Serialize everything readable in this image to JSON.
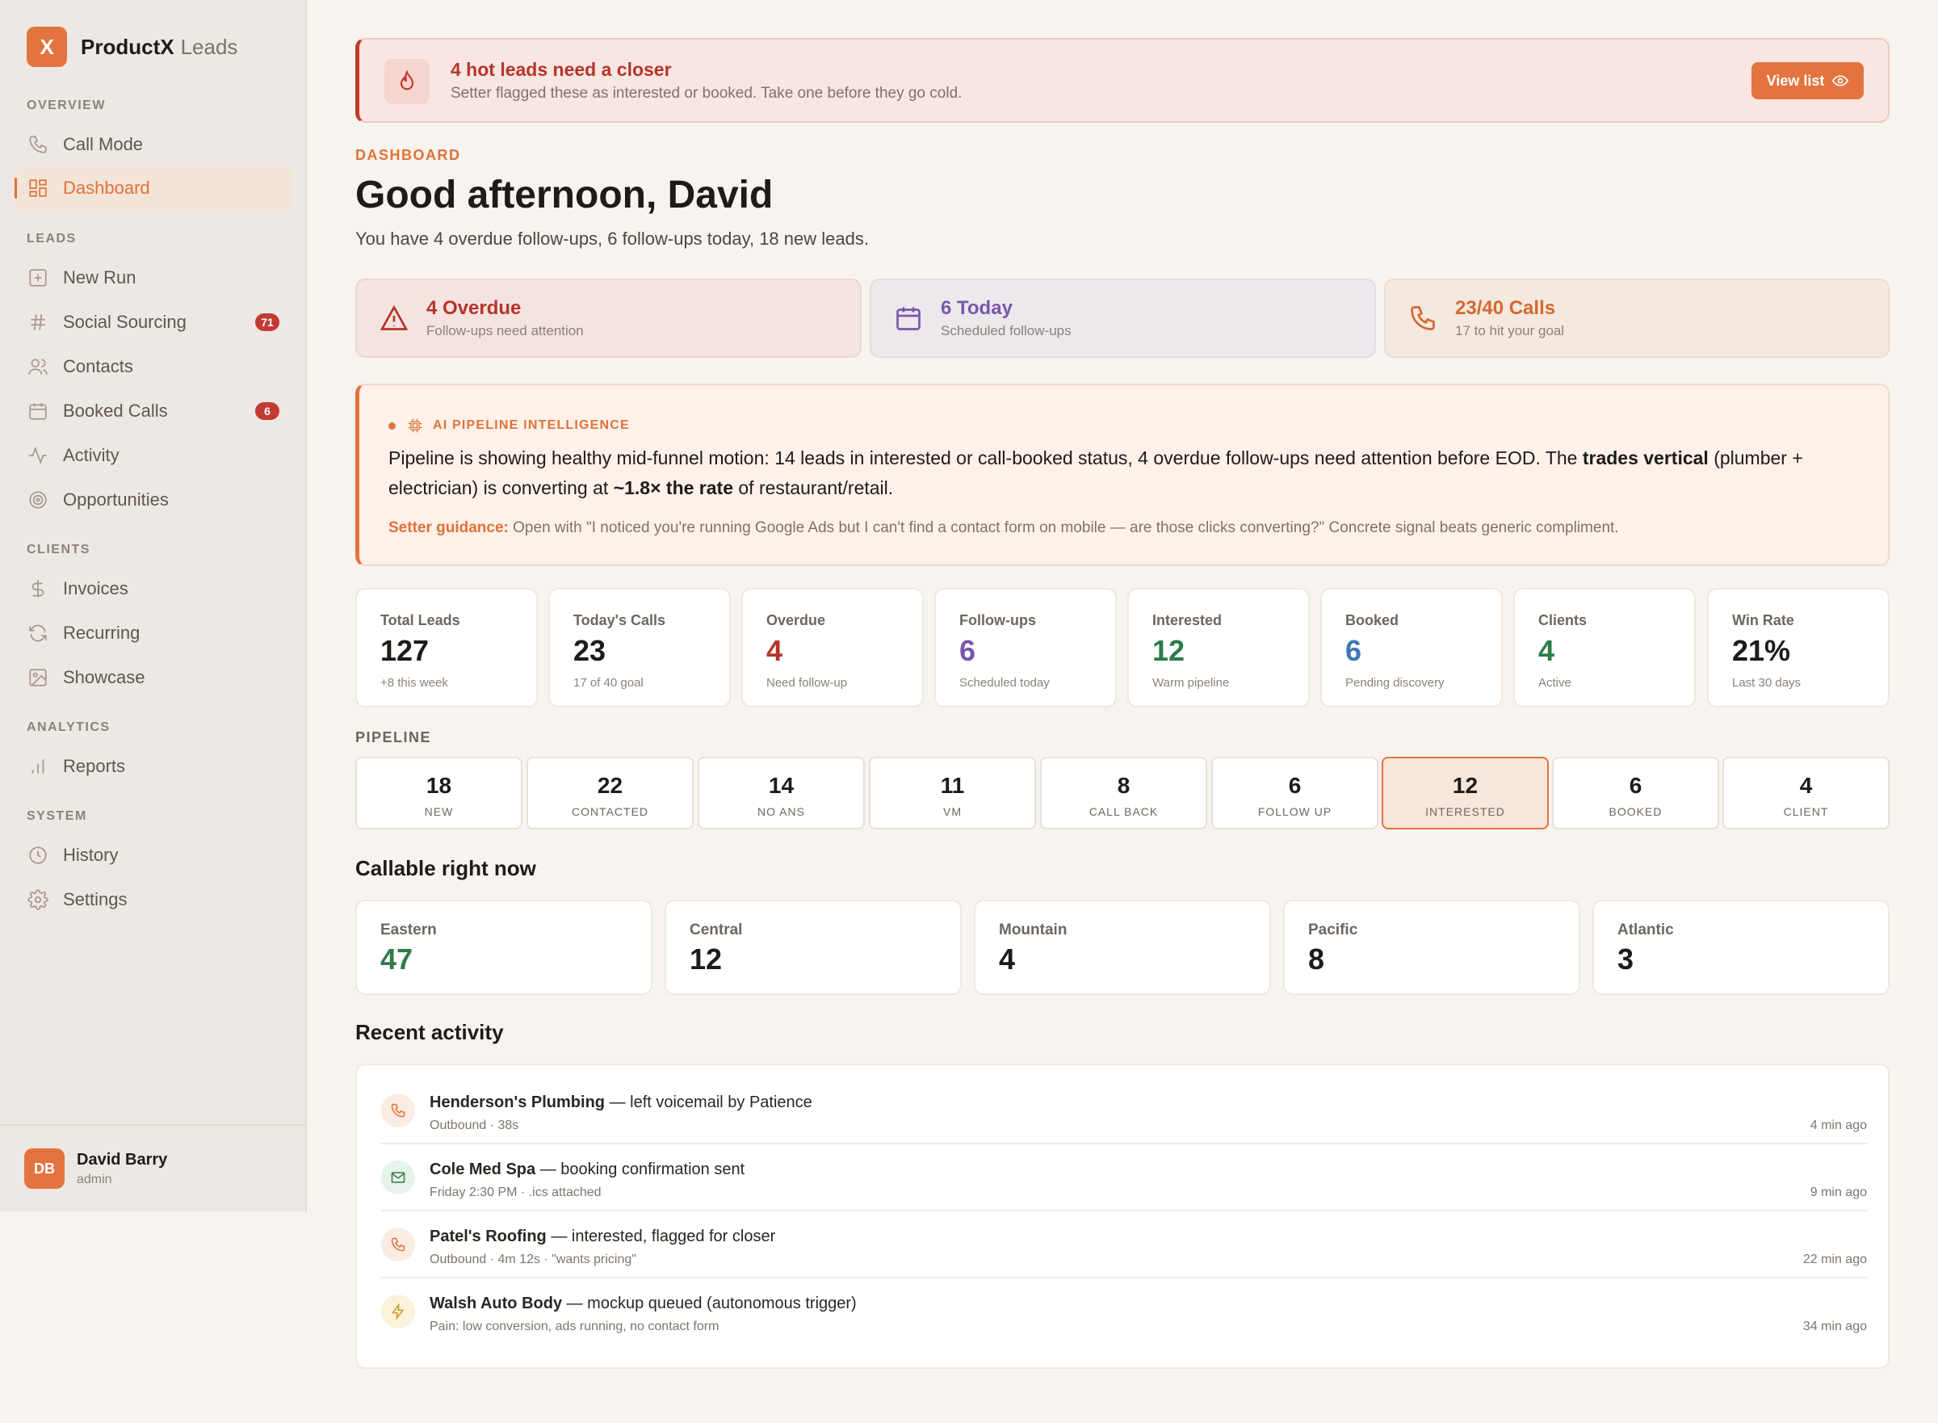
{
  "brand": {
    "logo_letter": "X",
    "name": "ProductX",
    "sub": "Leads"
  },
  "sidebar": {
    "sections": {
      "overview": "OVERVIEW",
      "leads": "LEADS",
      "clients": "CLIENTS",
      "analytics": "ANALYTICS",
      "system": "SYSTEM"
    },
    "items": {
      "call_mode": "Call Mode",
      "dashboard": "Dashboard",
      "new_run": "New Run",
      "social_sourcing": "Social Sourcing",
      "social_sourcing_badge": "71",
      "contacts": "Contacts",
      "booked_calls": "Booked Calls",
      "booked_calls_badge": "6",
      "activity": "Activity",
      "opportunities": "Opportunities",
      "invoices": "Invoices",
      "recurring": "Recurring",
      "showcase": "Showcase",
      "reports": "Reports",
      "history": "History",
      "settings": "Settings"
    },
    "user": {
      "initials": "DB",
      "name": "David Barry",
      "role": "admin"
    }
  },
  "alert": {
    "title": "4 hot leads need a closer",
    "subtitle": "Setter flagged these as interested or booked. Take one before they go cold.",
    "button": "View list"
  },
  "header": {
    "eyebrow": "DASHBOARD",
    "greeting": "Good afternoon, David",
    "summary": "You have 4 overdue follow-ups, 6 follow-ups today, 18 new leads."
  },
  "quick_cards": [
    {
      "title": "4 Overdue",
      "sub": "Follow-ups need attention",
      "color": "#b5342b"
    },
    {
      "title": "6 Today",
      "sub": "Scheduled follow-ups",
      "color": "#7a56ad"
    },
    {
      "title": "23/40 Calls",
      "sub": "17 to hit your goal",
      "color": "#d3692f"
    }
  ],
  "ai": {
    "label": "AI PIPELINE INTELLIGENCE",
    "body_1": "Pipeline is showing healthy mid-funnel motion: 14 leads in interested or call-booked status, 4 overdue follow-ups need attention before EOD. The ",
    "body_bold_1": "trades vertical",
    "body_2": " (plumber + electrician) is converting at ",
    "body_bold_2": "~1.8× the rate",
    "body_3": " of restaurant/retail.",
    "guidance_label": "Setter guidance:",
    "guidance": " Open with \"I noticed you're running Google Ads but I can't find a contact form on mobile — are those clicks converting?\" Concrete signal beats generic compliment."
  },
  "stats": [
    {
      "label": "Total Leads",
      "value": "127",
      "sub": "+8 this week",
      "color": "#1e1b18"
    },
    {
      "label": "Today's Calls",
      "value": "23",
      "sub": "17 of 40 goal",
      "color": "#1e1b18"
    },
    {
      "label": "Overdue",
      "value": "4",
      "sub": "Need follow-up",
      "color": "#b5342b"
    },
    {
      "label": "Follow-ups",
      "value": "6",
      "sub": "Scheduled today",
      "color": "#7a56ad"
    },
    {
      "label": "Interested",
      "value": "12",
      "sub": "Warm pipeline",
      "color": "#2f7a48"
    },
    {
      "label": "Booked",
      "value": "6",
      "sub": "Pending discovery",
      "color": "#3c78b4"
    },
    {
      "label": "Clients",
      "value": "4",
      "sub": "Active",
      "color": "#2f7a48"
    },
    {
      "label": "Win Rate",
      "value": "21%",
      "sub": "Last 30 days",
      "color": "#1e1b18"
    }
  ],
  "pipeline": {
    "label": "PIPELINE",
    "stages": [
      {
        "value": "18",
        "label": "NEW"
      },
      {
        "value": "22",
        "label": "CONTACTED"
      },
      {
        "value": "14",
        "label": "NO ANS"
      },
      {
        "value": "11",
        "label": "VM"
      },
      {
        "value": "8",
        "label": "CALL BACK"
      },
      {
        "value": "6",
        "label": "FOLLOW UP"
      },
      {
        "value": "12",
        "label": "INTERESTED"
      },
      {
        "value": "6",
        "label": "BOOKED"
      },
      {
        "value": "4",
        "label": "CLIENT"
      }
    ],
    "active_stage": "INTERESTED"
  },
  "callable": {
    "heading": "Callable right now",
    "zones": [
      {
        "label": "Eastern",
        "value": "47",
        "color": "#2f7a48"
      },
      {
        "label": "Central",
        "value": "12",
        "color": "#1e1b18"
      },
      {
        "label": "Mountain",
        "value": "4",
        "color": "#1e1b18"
      },
      {
        "label": "Pacific",
        "value": "8",
        "color": "#1e1b18"
      },
      {
        "label": "Atlantic",
        "value": "3",
        "color": "#1e1b18"
      }
    ]
  },
  "activity": {
    "heading": "Recent activity",
    "items": [
      {
        "icon": "phone-icon",
        "name": "Henderson's Plumbing",
        "action": " — left voicemail by Patience",
        "sub": "Outbound · 38s",
        "time": "4 min ago"
      },
      {
        "icon": "mail-icon",
        "name": "Cole Med Spa",
        "action": " — booking confirmation sent",
        "sub": "Friday 2:30 PM · .ics attached",
        "time": "9 min ago"
      },
      {
        "icon": "phone-icon",
        "name": "Patel's Roofing",
        "action": " — interested, flagged for closer",
        "sub": "Outbound · 4m 12s · \"wants pricing\"",
        "time": "22 min ago"
      },
      {
        "icon": "bolt-icon",
        "name": "Walsh Auto Body",
        "action": " — mockup queued (autonomous trigger)",
        "sub": "Pain: low conversion, ads running, no contact form",
        "time": "34 min ago"
      }
    ]
  }
}
